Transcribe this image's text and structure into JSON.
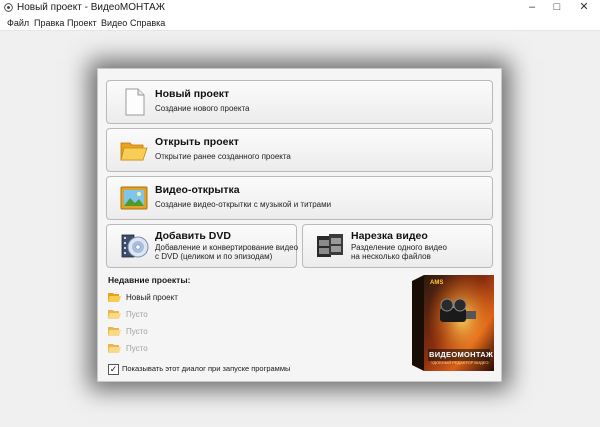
{
  "window": {
    "title": "Новый проект - ВидеоМОНТАЖ"
  },
  "menu": [
    "Файл",
    "Правка",
    "Проект",
    "Видео",
    "Справка"
  ],
  "actions": {
    "new_project": {
      "title": "Новый проект",
      "desc": "Создание нового проекта"
    },
    "open_project": {
      "title": "Открыть проект",
      "desc": "Открытие ранее созданного проекта"
    },
    "video_card": {
      "title": "Видео-открытка",
      "desc": "Создание видео-открытки с музыкой и титрами"
    },
    "add_dvd": {
      "title": "Добавить DVD",
      "desc1": "Добавление и конвертирование видео",
      "desc2": "с DVD (целиком и по эпизодам)"
    },
    "cut_video": {
      "title": "Нарезка видео",
      "desc1": "Разделение одного видео",
      "desc2": "на несколько файлов"
    }
  },
  "recent": {
    "title": "Недавние проекты:",
    "items": [
      "Новый проект",
      "Пусто",
      "Пусто",
      "Пусто"
    ]
  },
  "startup_checkbox": {
    "label": "Показывать этот диалог при запуске программы",
    "checked": true
  },
  "product_box": {
    "brand": "AMS",
    "name": "ВИДЕОМОНТАЖ",
    "tagline": "УДОБНЫЙ РЕДАКТОР ВИДЕО"
  }
}
